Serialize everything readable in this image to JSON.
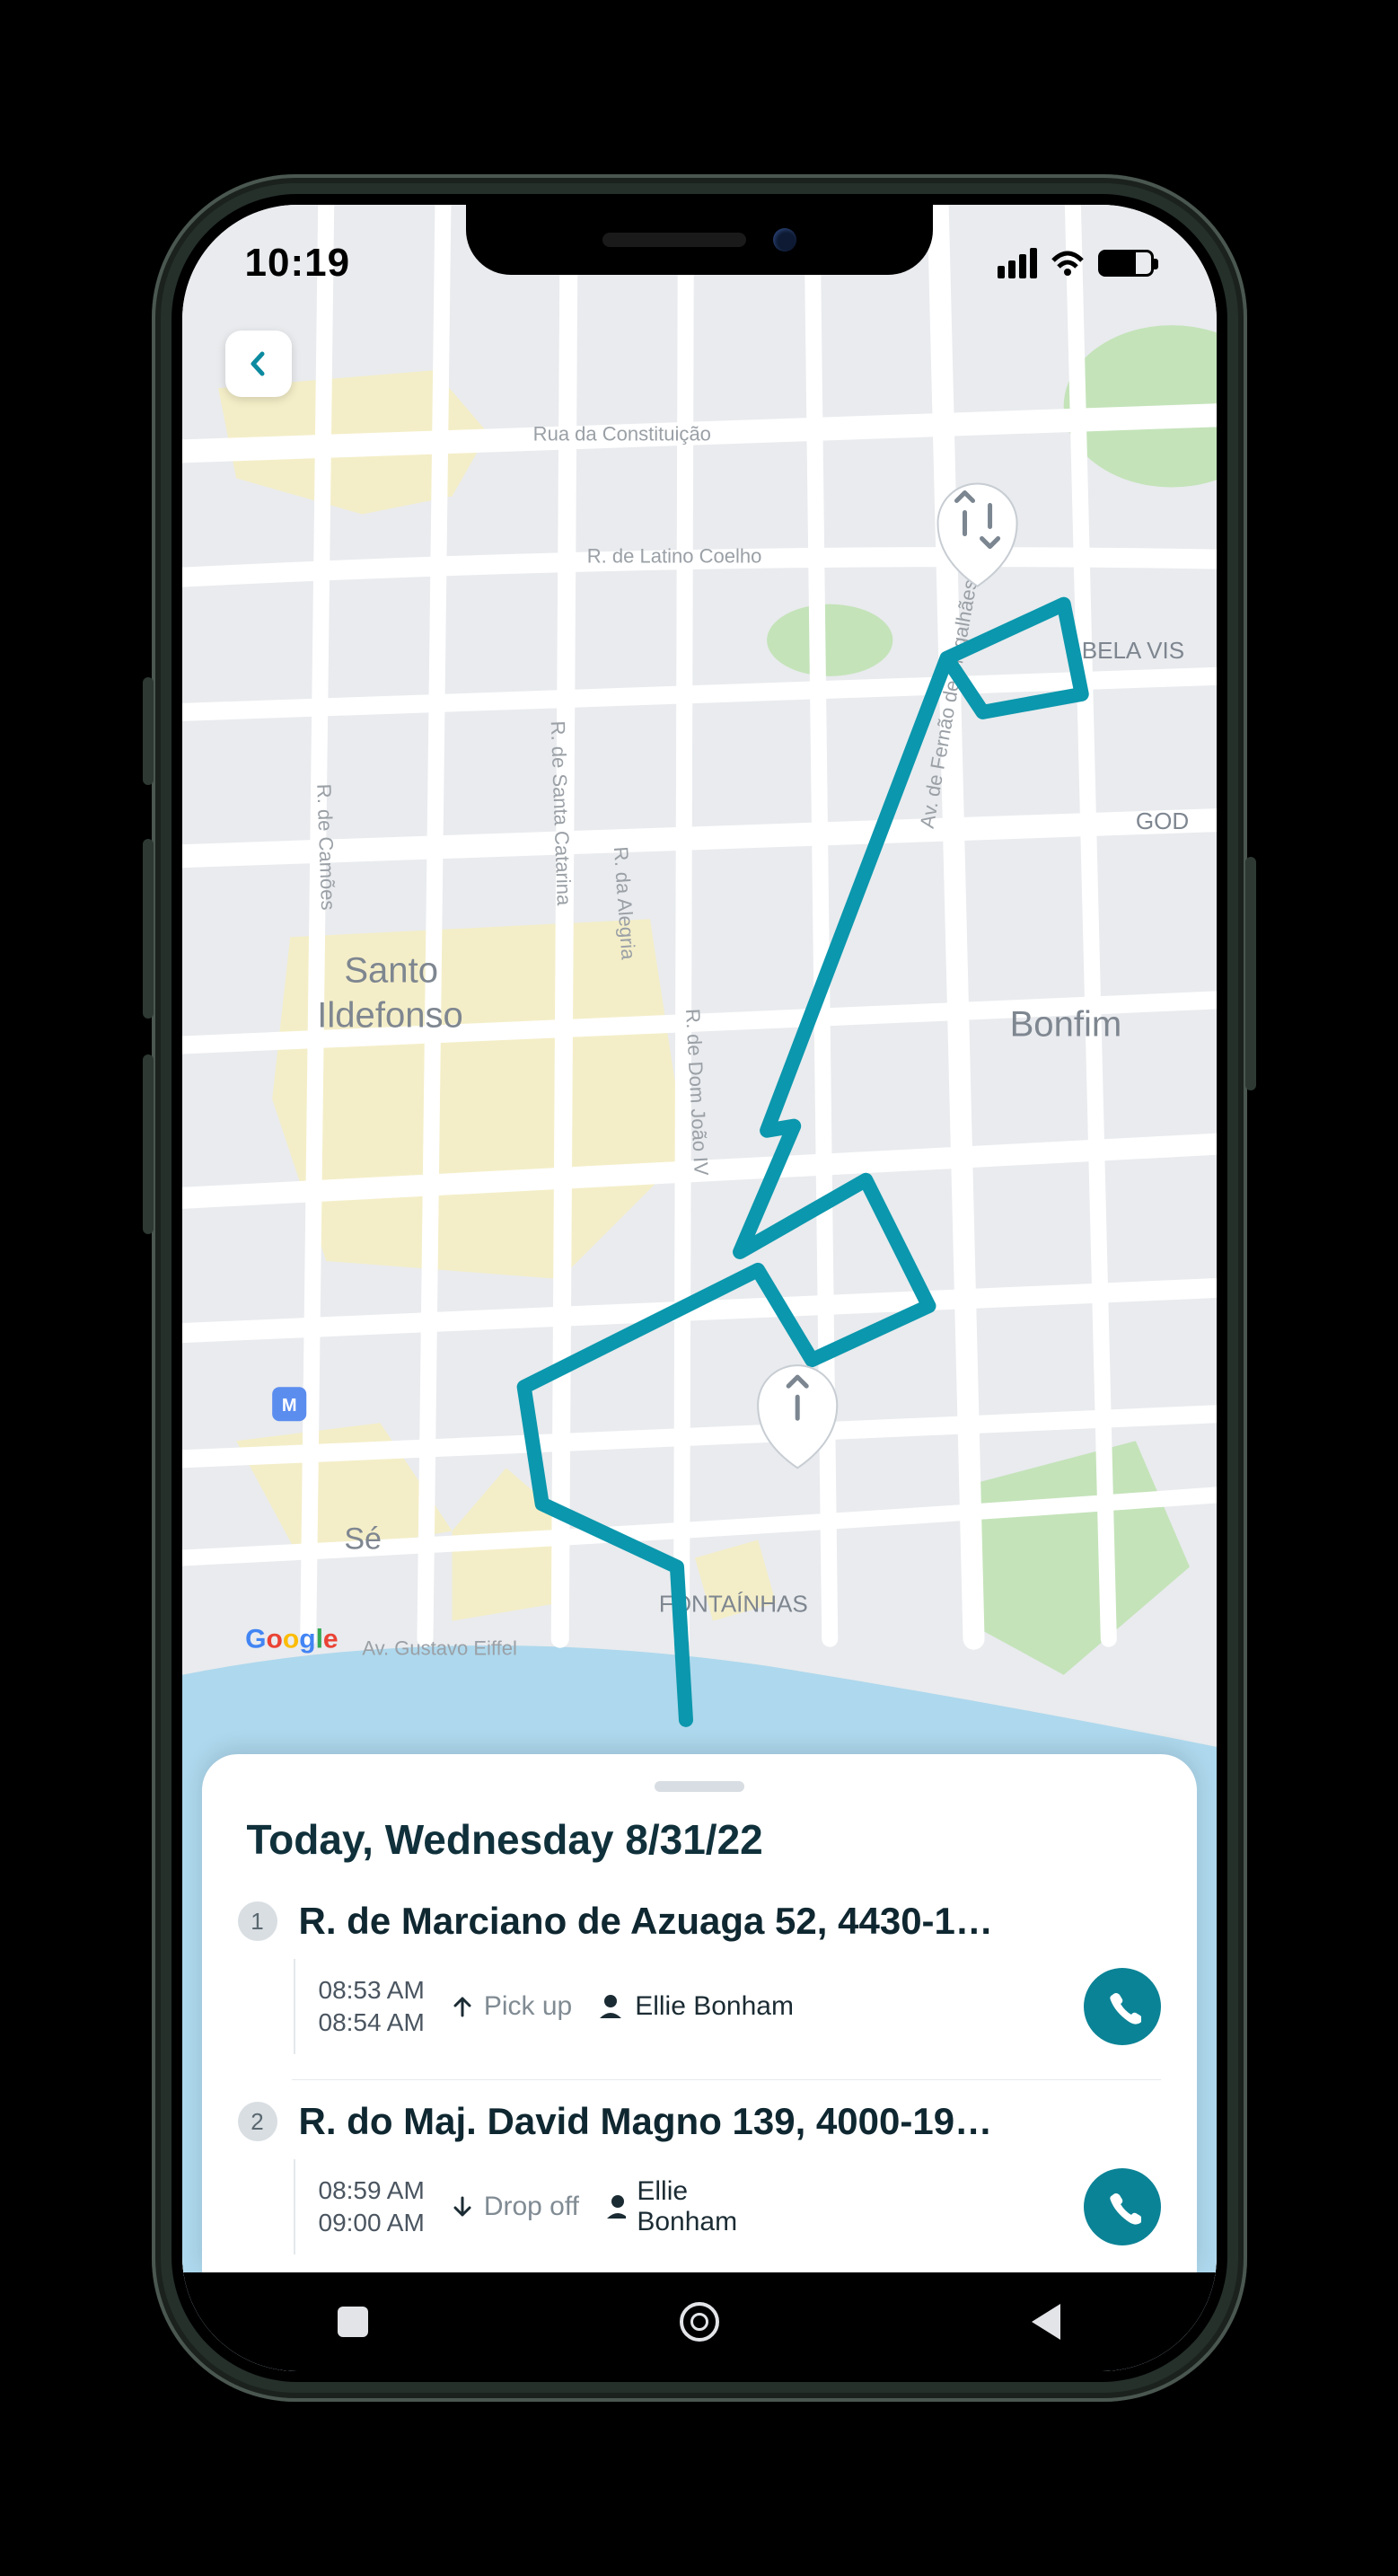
{
  "status": {
    "time": "10:19"
  },
  "map": {
    "roads": {
      "constituicao": "Rua da Constituição",
      "latino": "R. de Latino Coelho",
      "camoes": "R. de Camões",
      "catarina": "R. de Santa Catarina",
      "alegria": "R. da Alegria",
      "joao": "R. de Dom João IV",
      "magalhaes": "Av. de Fernão de Magalhães",
      "eiffel": "Av. Gustavo Eiffel"
    },
    "areas": {
      "ildefonso1": "Santo",
      "ildefonso2": "Ildefonso",
      "bonfim": "Bonfim",
      "se": "Sé",
      "fontainhas": "FONTAÍNHAS",
      "bela": "BELA VIS",
      "god": "GOD"
    },
    "attribution": "Google"
  },
  "sheet": {
    "title": "Today, Wednesday 8/31/22",
    "stops": [
      {
        "num": "1",
        "address": "R. de Marciano de Azuaga 52, 4430-1…",
        "time1": "08:53 AM",
        "time2": "08:54 AM",
        "action": "Pick up",
        "action_dir": "up",
        "person": "Ellie Bonham"
      },
      {
        "num": "2",
        "address": "R. do Maj. David Magno 139, 4000-19…",
        "time1": "08:59 AM",
        "time2": "09:00 AM",
        "action": "Drop off",
        "action_dir": "down",
        "person": "Ellie Bonham"
      }
    ]
  }
}
